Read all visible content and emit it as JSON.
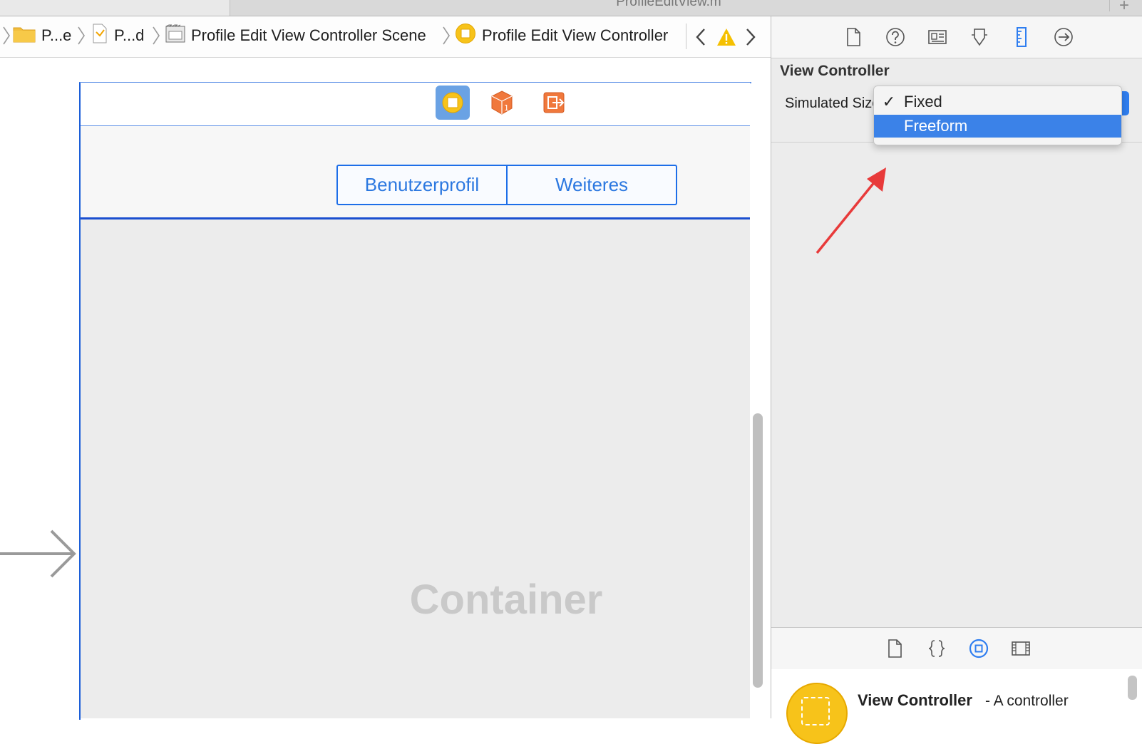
{
  "window": {
    "tab_title": "ProfileEditView.m",
    "add_tab_symbol": "+"
  },
  "jump_bar": {
    "crumbs": [
      {
        "label": "P...e",
        "icon": "folder-icon"
      },
      {
        "label": "P...d",
        "icon": "storyboard-file-icon"
      },
      {
        "label": "Profile Edit View Controller Scene",
        "icon": "scene-icon"
      },
      {
        "label": "Profile Edit View Controller",
        "icon": "view-controller-icon"
      }
    ],
    "nav_icons": [
      "chevron-left-icon",
      "warning-icon",
      "chevron-right-icon"
    ]
  },
  "canvas": {
    "scene_dock_icons": [
      "view-controller-icon",
      "first-responder-icon",
      "exit-icon"
    ],
    "segmented_control": [
      "Benutzerprofil",
      "Weiteres"
    ],
    "container_label": "Container"
  },
  "inspector": {
    "tabs": [
      "file-inspector-icon",
      "quick-help-icon",
      "identity-inspector-icon",
      "attributes-inspector-icon",
      "size-inspector-icon",
      "connections-inspector-icon"
    ],
    "active_tab": "size-inspector-icon",
    "section_title": "View Controller",
    "simulated_size_label": "Simulated Size",
    "dropdown": {
      "options": [
        {
          "label": "Fixed",
          "checked": true
        },
        {
          "label": "Freeform",
          "highlighted": true
        }
      ]
    }
  },
  "library": {
    "tabs": [
      "file-template-icon",
      "code-snippet-icon",
      "object-library-icon",
      "media-library-icon"
    ],
    "active_tab": "object-library-icon",
    "item_title": "View Controller",
    "item_desc": "- A controller"
  },
  "colors": {
    "accent_blue": "#2f7ef0",
    "selection_blue": "#3b82e8",
    "annotation_red": "#e83a3a",
    "vc_yellow": "#f7c31a",
    "warning_yellow": "#f5c000"
  }
}
